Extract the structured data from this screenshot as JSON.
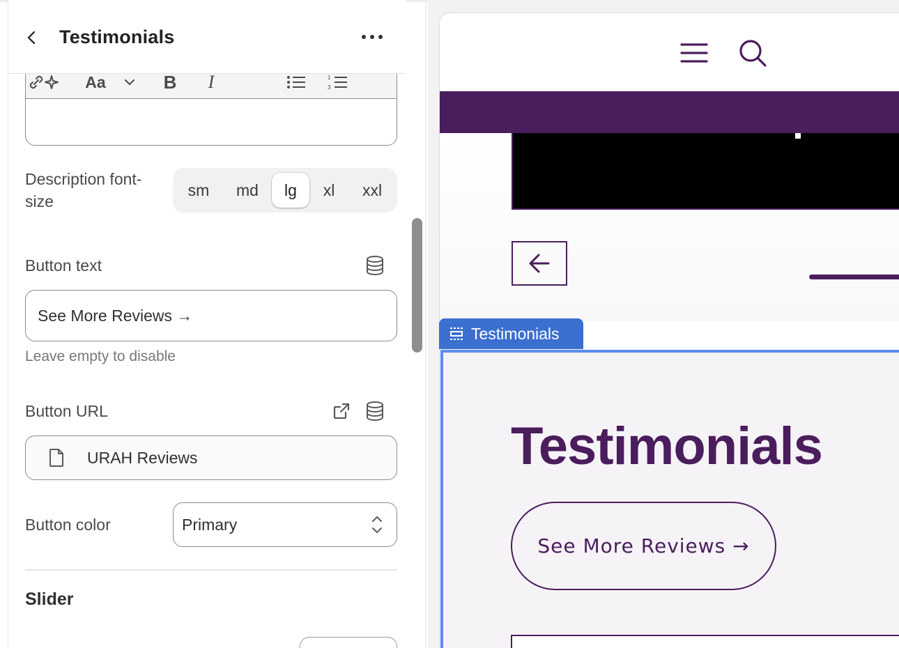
{
  "header": {
    "title": "Testimonials"
  },
  "icons": {
    "back": "chevron-left-icon",
    "more": "more-horizontal-icon",
    "database": "database-icon",
    "external": "external-link-icon",
    "page": "page-icon",
    "caret": "select-caret-icon"
  },
  "rte": {
    "toolbar": [
      "sparkle",
      "Aa",
      "chevron-down",
      "B",
      "I",
      "link",
      "bulleted-list",
      "numbered-list"
    ],
    "font_label": "Aa"
  },
  "description_font_size": {
    "label": "Description font-size",
    "options": [
      "sm",
      "md",
      "lg",
      "xl",
      "xxl"
    ],
    "selected": "lg"
  },
  "button_text": {
    "label": "Button text",
    "value": "See More Reviews →",
    "help": "Leave empty to disable"
  },
  "button_url": {
    "label": "Button URL",
    "value": "URAH Reviews"
  },
  "button_color": {
    "label": "Button color",
    "value": "Primary"
  },
  "slider": {
    "heading": "Slider"
  },
  "preview": {
    "section_tab": "Testimonials",
    "heading": "Testimonials",
    "button": "See More Reviews →",
    "brand_color": "#4a1d5c",
    "selection_color": "#3b6fd0"
  }
}
